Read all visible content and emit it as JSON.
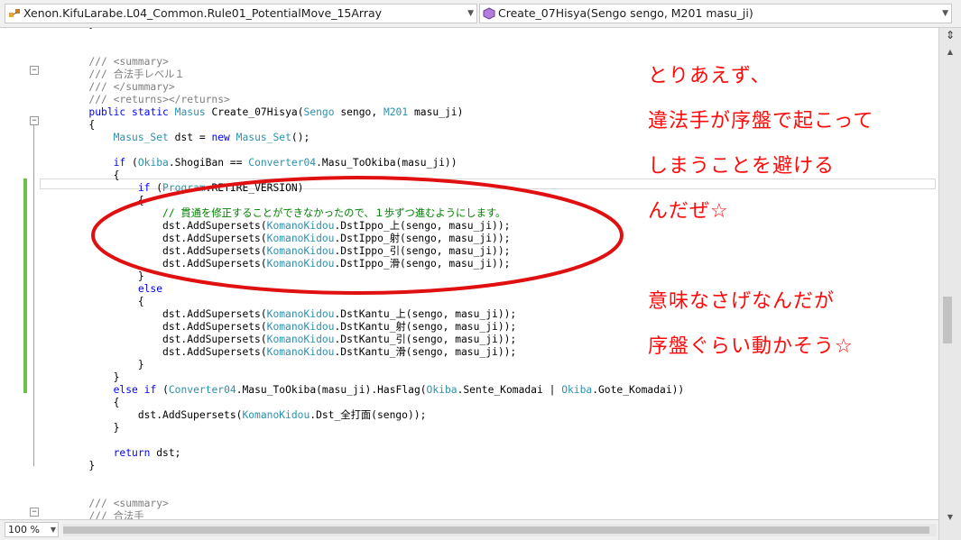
{
  "toolbar": {
    "type_combo": {
      "icon": "class-icon",
      "text": "Xenon.KifuLarabe.L04_Common.Rule01_PotentialMove_15Array"
    },
    "member_combo": {
      "icon": "method-icon",
      "text": "Create_07Hisya(Sengo sengo, M201 masu_ji)"
    }
  },
  "zoom": {
    "value": "100 %"
  },
  "annotations": {
    "note1": [
      "とりあえず、",
      "違法手が序盤で起こって",
      "しまうことを避ける",
      "んだぜ☆"
    ],
    "note2": [
      "意味なさげなんだが",
      "序盤ぐらい動かそう☆"
    ],
    "color": "#ff0a0a"
  },
  "code_lines": [
    "        }",
    "",
    "",
    "        /// <summary>",
    "        /// 合法手レベル１",
    "        /// </summary>",
    "        /// <returns></returns>",
    "        public static Masus Create_07Hisya(Sengo sengo, M201 masu_ji)",
    "        {",
    "            Masus_Set dst = new Masus_Set();",
    "",
    "            if (Okiba.ShogiBan == Converter04.Masu_ToOkiba(masu_ji))",
    "            {",
    "                if (Program.RETIRE_VERSION)",
    "                {",
    "                    // 貫通を修正することができなかったので、１歩ずつ進むようにします。",
    "                    dst.AddSupersets(KomanoKidou.DstIppo_上(sengo, masu_ji));",
    "                    dst.AddSupersets(KomanoKidou.DstIppo_射(sengo, masu_ji));",
    "                    dst.AddSupersets(KomanoKidou.DstIppo_引(sengo, masu_ji));",
    "                    dst.AddSupersets(KomanoKidou.DstIppo_滑(sengo, masu_ji));",
    "                }",
    "                else",
    "                {",
    "                    dst.AddSupersets(KomanoKidou.DstKantu_上(sengo, masu_ji));",
    "                    dst.AddSupersets(KomanoKidou.DstKantu_射(sengo, masu_ji));",
    "                    dst.AddSupersets(KomanoKidou.DstKantu_引(sengo, masu_ji));",
    "                    dst.AddSupersets(KomanoKidou.DstKantu_滑(sengo, masu_ji));",
    "                }",
    "            }",
    "            else if (Converter04.Masu_ToOkiba(masu_ji).HasFlag(Okiba.Sente_Komadai | Okiba.Gote_Komadai))",
    "            {",
    "                dst.AddSupersets(KomanoKidou.Dst_全打面(sengo));",
    "            }",
    "",
    "            return dst;",
    "        }",
    "",
    "",
    "        /// <summary>",
    "        /// 合法手"
  ],
  "highlight": {
    "keywords": [
      "public",
      "static",
      "new",
      "if",
      "else",
      "return"
    ],
    "types": [
      "Masus_Set",
      "Masus",
      "Sengo",
      "M201",
      "Okiba",
      "Converter04",
      "Program",
      "KomanoKidou"
    ]
  }
}
